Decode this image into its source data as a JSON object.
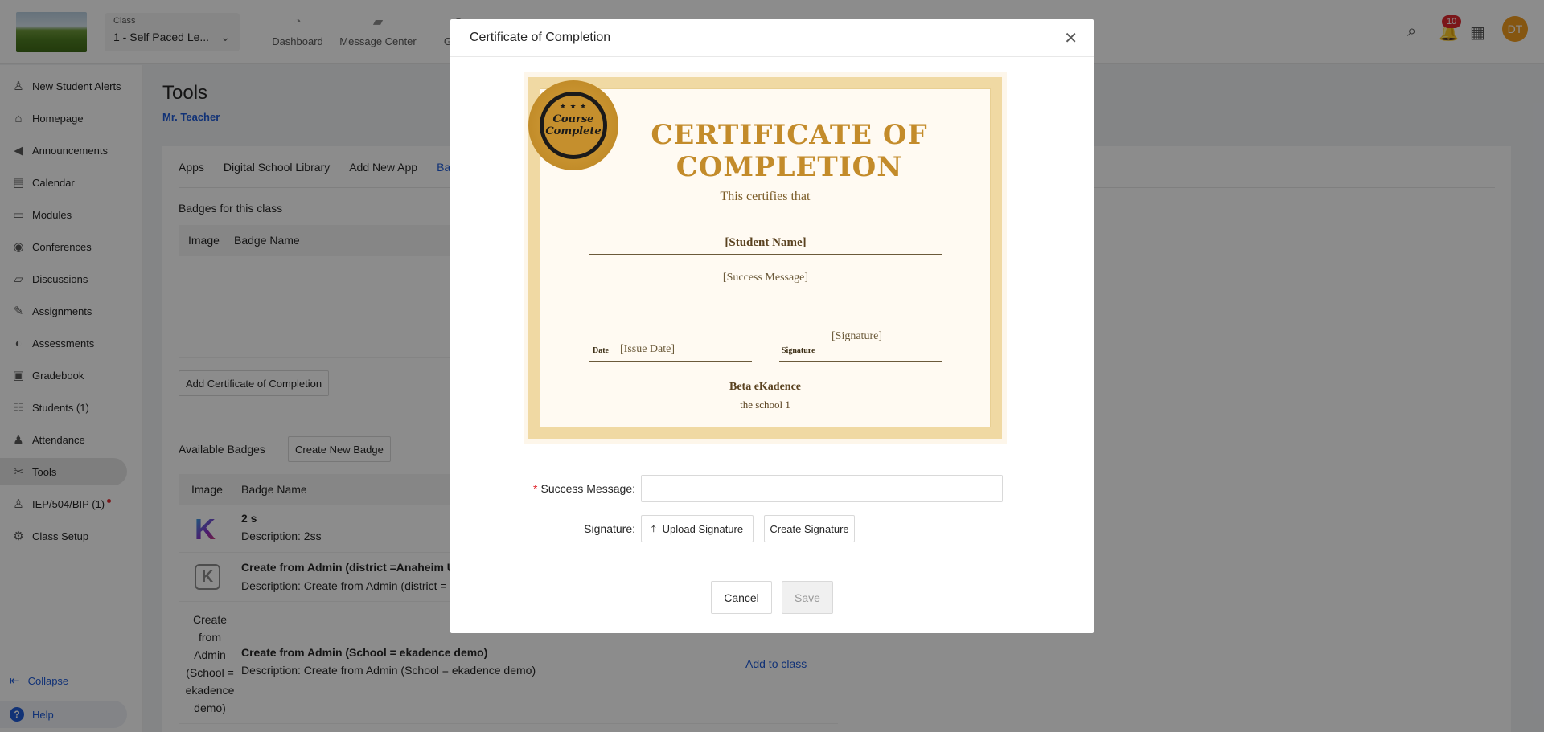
{
  "header": {
    "class_label": "Class",
    "class_value": "1 - Self Paced Le...",
    "nav": [
      {
        "icon": "dashboard-icon",
        "label": "Dashboard"
      },
      {
        "icon": "message-icon",
        "label": "Message Center"
      },
      {
        "icon": "group-icon",
        "label": "Group"
      }
    ],
    "notification_count": "10",
    "avatar_initials": "DT"
  },
  "sidebar": {
    "items": [
      {
        "icon": "user-alert-icon",
        "label": "New Student Alerts"
      },
      {
        "icon": "home-icon",
        "label": "Homepage"
      },
      {
        "icon": "megaphone-icon",
        "label": "Announcements"
      },
      {
        "icon": "calendar-icon",
        "label": "Calendar"
      },
      {
        "icon": "folder-icon",
        "label": "Modules"
      },
      {
        "icon": "conference-icon",
        "label": "Conferences"
      },
      {
        "icon": "discussion-icon",
        "label": "Discussions"
      },
      {
        "icon": "assignment-icon",
        "label": "Assignments"
      },
      {
        "icon": "assessment-icon",
        "label": "Assessments"
      },
      {
        "icon": "gradebook-icon",
        "label": "Gradebook"
      },
      {
        "icon": "students-icon",
        "label": "Students (1)"
      },
      {
        "icon": "attendance-icon",
        "label": "Attendance"
      },
      {
        "icon": "tools-icon",
        "label": "Tools"
      },
      {
        "icon": "iep-icon",
        "label": "IEP/504/BIP (1)"
      },
      {
        "icon": "gear-icon",
        "label": "Class Setup"
      }
    ],
    "collapse_label": "Collapse",
    "help_label": "Help"
  },
  "main": {
    "title": "Tools",
    "teacher": "Mr. Teacher",
    "tabs": [
      "Apps",
      "Digital School Library",
      "Add New App",
      "Ba"
    ],
    "badges_section_title": "Badges for this class",
    "table_headers": [
      "Image",
      "Badge Name"
    ],
    "add_certificate_button": "Add Certificate of Completion",
    "available_title": "Available Badges",
    "create_badge_button": "Create New Badge",
    "rows": [
      {
        "title": "2 s",
        "desc": "Description: 2ss"
      },
      {
        "title": "Create from Admin (district =Anaheim Un",
        "desc": "Description: Create from Admin (district ="
      },
      {
        "title": "Create from Admin (School = ekadence demo)",
        "desc": "Description: Create from Admin (School = ekadence demo)"
      }
    ],
    "broken_image_alt": "Create from Admin (School = ekadence demo)",
    "add_to_class": "Add to class"
  },
  "modal": {
    "title": "Certificate of Completion",
    "certificate": {
      "seal_text": "Course Complete",
      "heading_line1": "CERTIFICATE OF",
      "heading_line2": "COMPLETION",
      "certifies": "This certifies that",
      "student_name": "[Student Name]",
      "success_message": "[Success Message]",
      "date_label": "Date",
      "issue_date": "[Issue Date]",
      "signature_label": "Signature",
      "signature_value": "[Signature]",
      "school_name": "Beta eKadence",
      "school_sub": "the school 1"
    },
    "form": {
      "success_message_label": "Success Message",
      "success_message_value": "",
      "signature_label": "Signature",
      "upload_signature": "Upload Signature",
      "create_signature": "Create Signature"
    },
    "cancel": "Cancel",
    "save": "Save"
  },
  "colors": {
    "accent": "#1f5bd8",
    "gold": "#c38b2a",
    "badge_red": "#e0282e",
    "avatar": "#f29d1f"
  }
}
